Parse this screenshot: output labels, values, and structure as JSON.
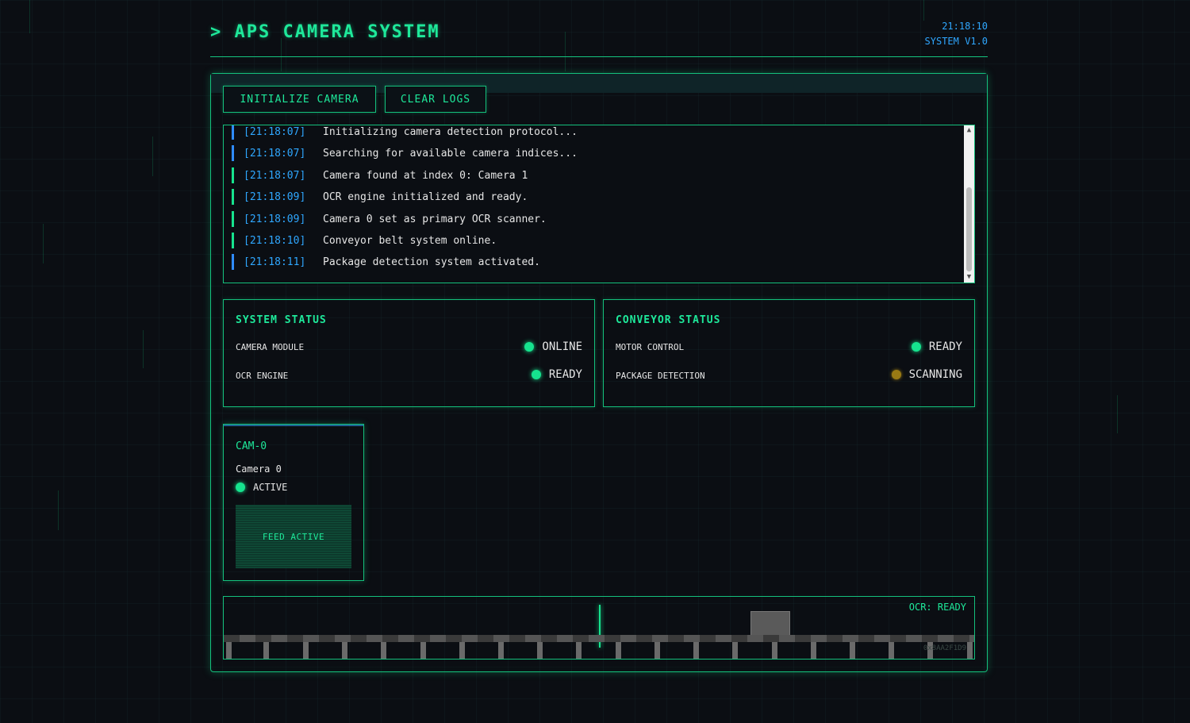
{
  "header": {
    "prompt": ">",
    "title": "APS CAMERA SYSTEM",
    "clock": "21:18:10",
    "version": "SYSTEM V1.0"
  },
  "toolbar": {
    "initialize_label": "INITIALIZE CAMERA",
    "clear_logs_label": "CLEAR LOGS"
  },
  "log": {
    "entries": [
      {
        "time": "[21:18:07]",
        "message": "Initializing camera detection protocol...",
        "level": "info"
      },
      {
        "time": "[21:18:07]",
        "message": "Searching for available camera indices...",
        "level": "info"
      },
      {
        "time": "[21:18:07]",
        "message": "Camera found at index 0: Camera 1",
        "level": "success"
      },
      {
        "time": "[21:18:09]",
        "message": "OCR engine initialized and ready.",
        "level": "success"
      },
      {
        "time": "[21:18:09]",
        "message": "Camera 0 set as primary OCR scanner.",
        "level": "success"
      },
      {
        "time": "[21:18:10]",
        "message": "Conveyor belt system online.",
        "level": "success"
      },
      {
        "time": "[21:18:11]",
        "message": "Package detection system activated.",
        "level": "info"
      }
    ]
  },
  "system_status": {
    "title": "SYSTEM STATUS",
    "rows": [
      {
        "label": "CAMERA MODULE",
        "status": "ONLINE",
        "color": "green"
      },
      {
        "label": "OCR ENGINE",
        "status": "READY",
        "color": "green"
      }
    ]
  },
  "conveyor_status": {
    "title": "CONVEYOR STATUS",
    "rows": [
      {
        "label": "MOTOR CONTROL",
        "status": "READY",
        "color": "green"
      },
      {
        "label": "PACKAGE DETECTION",
        "status": "SCANNING",
        "color": "amber"
      }
    ]
  },
  "camera": {
    "id": "CAM-0",
    "name": "Camera 0",
    "status": "ACTIVE",
    "feed_label": "FEED ACTIVE"
  },
  "conveyor": {
    "ocr_label": "OCR: READY",
    "hex_code": "0x8AA2F1D9"
  },
  "colors": {
    "accent_green": "#1ee89a",
    "timestamp_blue": "#2fa7ff",
    "info_bar": "#2f8cff",
    "success_bar": "#16e38e",
    "warning_amber": "#9a7a14"
  }
}
